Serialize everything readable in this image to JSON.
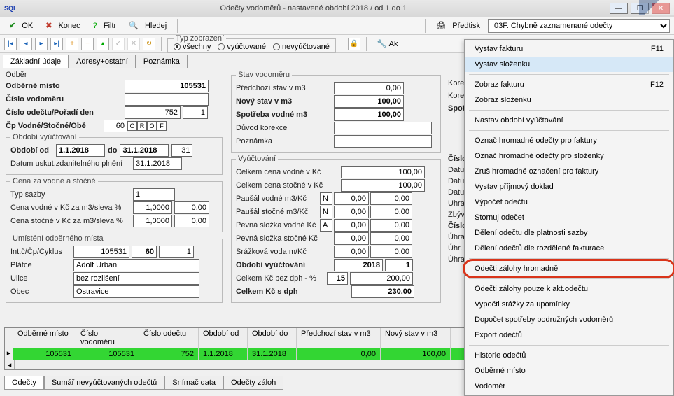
{
  "title": "Odečty vodoměrů - nastavené období 2018 / od 1 do 1",
  "toolbar": {
    "ok": "OK",
    "konec": "Konec",
    "filtr": "Filtr",
    "hledej": "Hledej",
    "predtisk": "Předtisk",
    "predtisk_sel": "03F. Chybně zaznamenané odečty",
    "typ_zobraz": "Typ zobrazení",
    "r_vsechny": "všechny",
    "r_vyuct": "vyúčtované",
    "r_nevyuct": "nevyúčtované",
    "akce": "Ak"
  },
  "tabs": {
    "t1": "Základní údaje",
    "t2": "Adresy+ostatní",
    "t3": "Poznámka"
  },
  "left": {
    "odber": "Odběr",
    "odb_misto_l": "Odběrné místo",
    "odb_misto_v": "105531",
    "cislo_vodo_l": "Číslo vodoměru",
    "cislo_odectu_l": "Číslo odečtu/Pořadí den",
    "cislo_odectu_v": "752",
    "poradi_v": "1",
    "cp_l": "Čp  Vodné/Stočné/Obě",
    "cp_v": "60",
    "cp_o": "O",
    "cp_r": "R",
    "cp_o2": "O",
    "cp_f": "F",
    "obd_leg": "Období vyúčtování",
    "obd_od_l": "Období od",
    "obd_od_v": "1.1.2018",
    "obd_do_l": "do",
    "obd_do_v": "31.1.2018",
    "obd_dni": "31",
    "datum_uskut_l": "Datum uskut.zdanitelného plnění",
    "datum_uskut_v": "31.1.2018",
    "cena_leg": "Cena za vodné a stočné",
    "typ_sazby_l": "Typ sazby",
    "typ_sazby_v": "1",
    "cena_vod_l": "Cena vodné v Kč za m3/sleva %",
    "cena_vod_v": "1,0000",
    "cena_vod_s": "0,00",
    "cena_sto_l": "Cena stočné v Kč za m3/sleva %",
    "cena_sto_v": "1,0000",
    "cena_sto_s": "0,00",
    "umist_leg": "Umístění odběrného místa",
    "intc_l": "Int.č/Čp/Cyklus",
    "intc1": "105531",
    "intc2": "60",
    "intc3": "1",
    "platce_l": "Plátce",
    "platce_v": "Adolf Urban",
    "ulice_l": "Ulice",
    "ulice_v": "bez rozlišení",
    "obec_l": "Obec",
    "obec_v": "Ostravice"
  },
  "mid": {
    "stav_leg": "Stav vodoměru",
    "pred_l": "Předchozí stav v m3",
    "pred_v": "0,00",
    "novy_l": "Nový stav v m3",
    "novy_v": "100,00",
    "spotr_l": "Spotřeba vodné m3",
    "spotr_v": "100,00",
    "duvod_l": "Důvod korekce",
    "pozn_l": "Poznámka",
    "vyuct_leg": "Vyúčtování",
    "cena_vod_l": "Celkem cena vodné v Kč",
    "cena_vod_v": "100,00",
    "cena_sto_l": "Celkem cena stočné v Kč",
    "cena_sto_v": "100,00",
    "paus_v_l": "Paušál vodné m3/Kč",
    "paus_v_f": "N",
    "paus_v_1": "0,00",
    "paus_v_2": "0,00",
    "paus_s_l": "Paušál stočné m3/Kč",
    "paus_s_f": "N",
    "paus_s_1": "0,00",
    "paus_s_2": "0,00",
    "pevna_v_l": "Pevná složka vodné Kč",
    "pevna_v_f": "A",
    "pevna_v_1": "0,00",
    "pevna_v_2": "0,00",
    "pevna_s_l": "Pevná složka stočné Kč",
    "pevna_s_1": "0,00",
    "pevna_s_2": "0,00",
    "sraz_l": "Srážková voda m/Kč",
    "sraz_1": "0,00",
    "sraz_2": "0,00",
    "obd_vy_l": "Období vyúčtování",
    "obd_vy_v": "2018",
    "obd_vy_n": "1",
    "celkem_bez_l": "Celkem Kč bez dph  - %",
    "celkem_bez_p": "15",
    "celkem_bez_v": "200,00",
    "celkem_s_l": "Celkem Kč s dph",
    "celkem_s_v": "230,00"
  },
  "right": {
    "kor_v": "Korekce odpočet v",
    "kor_s": "Korekce odpočet s",
    "spotr_stoc": "Spotřeba stočn",
    "cislo_fakt": "Číslo fakt",
    "datum_vyst": "Datum vyst",
    "datum_du": "Datum DU:",
    "datum_uhr": "Datum úhra",
    "uhrazeno": "Uhrazeno",
    "zbyva": "Zbývá k úh",
    "cislo_sloz": "Číslo slož",
    "uhrada_slo": "Úhrada slo",
    "uhr_datum": "Úhr. datum",
    "uhrada_sni": "Úhrada sni"
  },
  "grid": {
    "h1": "Odběrné místo",
    "h2": "Číslo vodoměru",
    "h3": "Číslo odečtu",
    "h4": "Období od",
    "h5": "Období do",
    "h6": "Předchozí stav v m3",
    "h7": "Nový stav v m3",
    "r1c1": "105531",
    "r1c2": "105531",
    "r1c3": "752",
    "r1c4": "1.1.2018",
    "r1c5": "31.1.2018",
    "r1c6": "0,00",
    "r1c7": "100,00"
  },
  "btabs": {
    "t1": "Odečty",
    "t2": "Sumář nevyúčtovaných odečtů",
    "t3": "Snímač data",
    "t4": "Odečty záloh"
  },
  "menu": {
    "m1": "Vystav fakturu",
    "m1k": "F11",
    "m2": "Vystav složenku",
    "m3": "Zobraz fakturu",
    "m3k": "F12",
    "m4": "Zobraz složenku",
    "m5": "Nastav období vyúčtování",
    "m6": "Označ hromadné odečty pro  faktury",
    "m7": "Označ hromadné odečty pro složenky",
    "m8": "Zruš hromadné označení pro faktury",
    "m9": "Vystav příjmový doklad",
    "m10": "Výpočet odečtu",
    "m11": "Stornuj odečet",
    "m12": "Dělení odečtu dle platnosti sazby",
    "m13": "Dělení odečtů dle rozdělené fakturace",
    "m14": "Odečti zálohy hromadně",
    "m15": "Odečti zálohy pouze k akt.odečtu",
    "m16": "Vypočti srážky za upomínky",
    "m17": "Dopočet spotřeby podružných vodoměrů",
    "m18": "Export odečtů",
    "m19": "Historie odečtů",
    "m20": "Odběrné místo",
    "m21": "Vodoměr"
  }
}
